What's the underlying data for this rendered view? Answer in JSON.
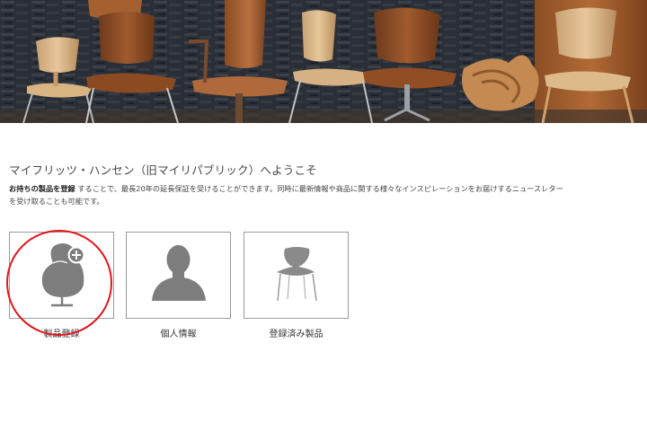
{
  "welcome": {
    "title": "マイフリッツ・ハンセン（旧マイリパブリック）へようこそ",
    "lead": "お持ちの製品を登録",
    "body_1": "することで、最長20年の延長保証を受けることができます。同時に最新情報や商品に関する様々なインスピレーションをお届けするニュースレター",
    "body_2": "を受け取ることも可能です。"
  },
  "cards": [
    {
      "label": "製品登録",
      "icon": "egg-chair-add-icon",
      "highlighted": true
    },
    {
      "label": "個人情報",
      "icon": "person-silhouette-icon"
    },
    {
      "label": "登録済み製品",
      "icon": "series7-chair-icon"
    }
  ],
  "colors": {
    "highlight_ring": "#e0161b",
    "icon_gray": "#7d7d7d",
    "card_border": "#9a9a9a"
  }
}
